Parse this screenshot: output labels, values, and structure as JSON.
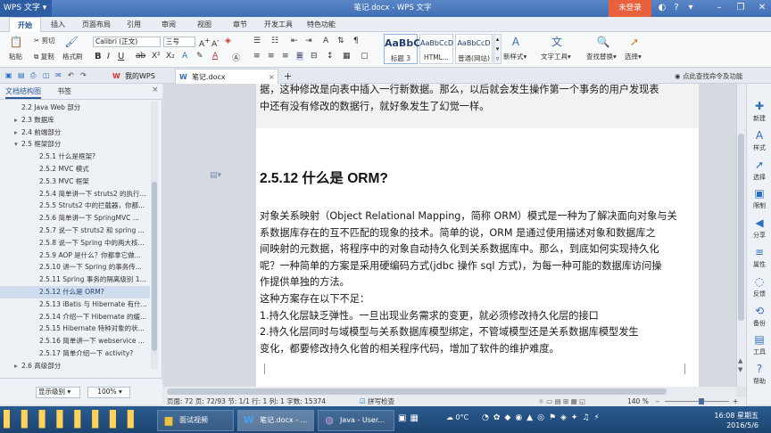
{
  "window": {
    "app_name": "WPS 文字",
    "title": "笔记.docx - WPS 文字",
    "login_label": "未登录"
  },
  "menu": {
    "tabs": [
      "开始",
      "插入",
      "页面布局",
      "引用",
      "审阅",
      "视图",
      "章节",
      "开发工具",
      "特色功能"
    ]
  },
  "ribbon": {
    "paste": "粘贴",
    "cut": "剪切",
    "copy": "复制",
    "format_painter": "格式刷",
    "font_name": "Calibri (正文)",
    "font_size": "三号",
    "styles": [
      {
        "preview": "AaBbC",
        "label": "标题 3"
      },
      {
        "preview": "AaBbCcD",
        "label": "HTML..."
      },
      {
        "preview": "AaBbCcD",
        "label": "普通(网站)"
      }
    ],
    "new_style": "新样式",
    "text_tool": "文字工具",
    "find_replace": "查找替换",
    "select": "选择"
  },
  "quickbar": {
    "my_wps": "我的WPS",
    "doc_tab": "笔记.docx",
    "hint": "点此查找命令及功能"
  },
  "nav": {
    "tab_outline": "文档结构图",
    "tab_bookmarks": "书签",
    "items": [
      {
        "label": "2.2 Java Web 部分",
        "indent": 2
      },
      {
        "label": "2.3 数据库",
        "indent": 2,
        "toggle": "▸"
      },
      {
        "label": "2.4 前端部分",
        "indent": 2,
        "toggle": "▸"
      },
      {
        "label": "2.5 框架部分",
        "indent": 2,
        "toggle": "▾"
      },
      {
        "label": "2.5.1 什么是框架?",
        "indent": 3
      },
      {
        "label": "2.5.2 MVC 模式",
        "indent": 3
      },
      {
        "label": "2.5.3 MVC 框架",
        "indent": 3
      },
      {
        "label": "2.5.4 简单讲一下 struts2 的执行...",
        "indent": 3
      },
      {
        "label": "2.5.5 Struts2 中的拦截器，你都...",
        "indent": 3
      },
      {
        "label": "2.5.6 简单讲一下 SpringMVC ...",
        "indent": 3
      },
      {
        "label": "2.5.7 说一下 struts2 和 spring ...",
        "indent": 3
      },
      {
        "label": "2.5.8 说一下 Spring 中的两大核...",
        "indent": 3
      },
      {
        "label": "2.5.9 AOP 是什么？你都拿它做...",
        "indent": 3
      },
      {
        "label": "2.5.10 讲一下 Spring 的事务传...",
        "indent": 3
      },
      {
        "label": "2.5.11 Spring 事务的隔离级别 1...",
        "indent": 3
      },
      {
        "label": "2.5.12 什么是 ORM?",
        "indent": 3,
        "selected": true
      },
      {
        "label": "2.5.13 iBatis 与 Hibernate 有什...",
        "indent": 3
      },
      {
        "label": "2.5.14 介绍一下 Hibernate 的缓...",
        "indent": 3
      },
      {
        "label": "2.5.15 Hibernate 特种对象的状...",
        "indent": 3
      },
      {
        "label": "2.5.16 简单讲一下 webservice ...",
        "indent": 3
      },
      {
        "label": "2.5.17 简单介绍一下 activity?",
        "indent": 3
      },
      {
        "label": "2.6 高级部分",
        "indent": 2,
        "toggle": "▸"
      }
    ],
    "level_label": "显示级别",
    "zoom_value": "100%"
  },
  "doc": {
    "top_lines": [
      "据，这种修改是向表中插入一行新数据。那么，以后就会发生操作第一个事务的用户发现表",
      "中还有没有修改的数据行，就好象发生了幻觉一样。"
    ],
    "heading": "2.5.12  什么是 ORM?",
    "body_lines": [
      "  对象关系映射（Object Relational Mapping，简称 ORM）模式是一种为了解决面向对象与关",
      "系数据库存在的互不匹配的现象的技术。简单的说，ORM 是通过使用描述对象和数据库之",
      "间映射的元数据，将程序中的对象自动持久化到关系数据库中。那么，到底如何实现持久化",
      "呢？一种简单的方案是采用硬编码方式(jdbc 操作 sql 方式)，为每一种可能的数据库访问操",
      "作提供单独的方法。",
      "这种方案存在以下不足：",
      "        1.持久化层缺乏弹性。一旦出现业务需求的变更，就必须修改持久化层的接口",
      "        2.持久化层同时与域模型与关系数据库模型绑定，不管域模型还是关系数据库模型发生",
      "变化，都要修改持久化曾的相关程序代码，增加了软件的维护难度。"
    ]
  },
  "right_panel": {
    "items": [
      "新建",
      "样式",
      "选择",
      "限制",
      "分享",
      "属性",
      "反馈",
      "备份",
      "工具",
      "帮助"
    ]
  },
  "status": {
    "page_info": "页面: 72  页: 72/93  节: 1/1  行: 1  列: 1  字数: 15374",
    "spell_check": "拼写检查",
    "zoom": "140 %"
  },
  "taskbar": {
    "tasks": [
      "面试视频",
      "笔记.docx - ...",
      "Java - User..."
    ],
    "weather": "0°C",
    "time": "16:08 星期五",
    "date": "2016/5/6"
  }
}
